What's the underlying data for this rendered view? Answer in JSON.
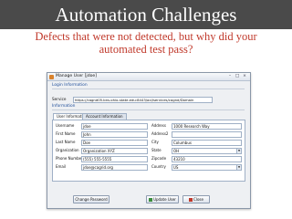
{
  "slide": {
    "title": "Automation Challenges",
    "subtitle": "Defects that were not detected, but why did your automated test pass?",
    "colors": {
      "header_bg": "#4a4a4a",
      "title": "#ffffff",
      "subtitle": "#c0392b"
    }
  },
  "window": {
    "title": "Manage User [jdoe]",
    "minimize_icon": "minimize-icon",
    "maximize_icon": "maximize-icon",
    "close_icon": "close-icon"
  },
  "login_section": {
    "heading": "Login Information",
    "service_label": "Service",
    "service_value": "https://cagnd05.bns.ohio-state.edu:8443/axl/services/cagnd/Domain"
  },
  "info_section": {
    "heading": "Information"
  },
  "tabs": [
    {
      "label": "User Information",
      "active": true
    },
    {
      "label": "Account Information",
      "active": false
    }
  ],
  "form": {
    "left": [
      {
        "label": "Username",
        "value": "jdoe"
      },
      {
        "label": "First Name",
        "value": "John"
      },
      {
        "label": "Last Name",
        "value": "Doe"
      },
      {
        "label": "Organization",
        "value": "Organization XYZ"
      },
      {
        "label": "Phone Number",
        "value": "(555) 555-5555"
      },
      {
        "label": "Email",
        "value": "jdoe@cagrid.org"
      }
    ],
    "right": [
      {
        "label": "Address",
        "value": "1000 Research Way"
      },
      {
        "label": "Address2",
        "value": ""
      },
      {
        "label": "City",
        "value": "Columbus"
      },
      {
        "label": "State",
        "value": "OH"
      },
      {
        "label": "Zipcode",
        "value": "43210"
      },
      {
        "label": "Country",
        "value": "US"
      }
    ]
  },
  "buttons": {
    "change_password": "Change Password",
    "update_user": "Update User",
    "close": "Close"
  }
}
